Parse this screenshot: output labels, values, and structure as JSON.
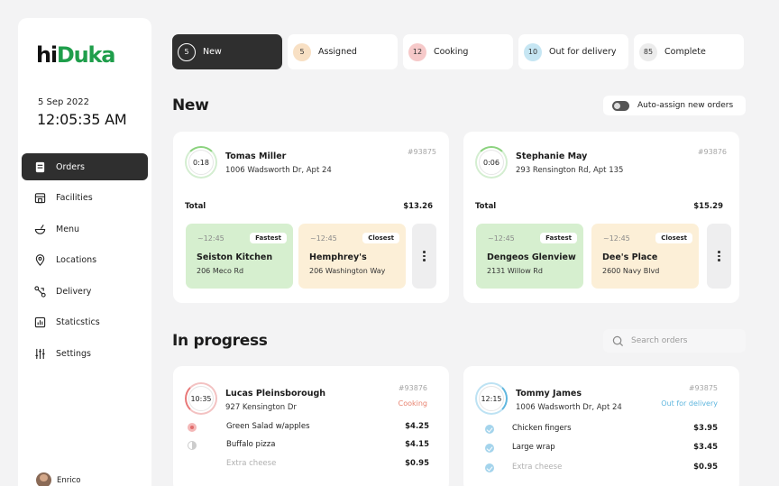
{
  "app": {
    "logo_hi": "hi",
    "logo_duka": "Duka"
  },
  "sidebar": {
    "date": "5 Sep 2022",
    "time": "12:05:35 AM",
    "items": [
      {
        "label": "Orders",
        "icon": "receipt-icon",
        "active": true
      },
      {
        "label": "Facilities",
        "icon": "storefront-icon"
      },
      {
        "label": "Menu",
        "icon": "bowl-icon"
      },
      {
        "label": "Locations",
        "icon": "map-pin-icon"
      },
      {
        "label": "Delivery",
        "icon": "route-icon"
      },
      {
        "label": "Staticstics",
        "icon": "bar-chart-icon"
      },
      {
        "label": "Settings",
        "icon": "sliders-icon"
      }
    ],
    "user": "Enrico"
  },
  "tabs": [
    {
      "count": "5",
      "label": "New",
      "active": true
    },
    {
      "count": "5",
      "label": "Assigned"
    },
    {
      "count": "12",
      "label": "Cooking"
    },
    {
      "count": "10",
      "label": "Out for delivery"
    },
    {
      "count": "85",
      "label": "Complete"
    }
  ],
  "new_section": {
    "title": "New",
    "auto_assign_label": "Auto-assign new orders",
    "orders": [
      {
        "timer": "0:18",
        "name": "Tomas Miller",
        "address": "1006 Wadsworth Dr, Apt 24",
        "id": "#93875",
        "total_label": "Total",
        "total": "$13.26",
        "options": [
          {
            "eta": "~12:45",
            "badge": "Fastest",
            "name": "Seiston Kitchen",
            "address": "206 Meco Rd"
          },
          {
            "eta": "~12:45",
            "badge": "Closest",
            "name": "Hemphrey's",
            "address": "206 Washington Way"
          }
        ]
      },
      {
        "timer": "0:06",
        "name": "Stephanie May",
        "address": "293 Rensington Rd, Apt 135",
        "id": "#93876",
        "total_label": "Total",
        "total": "$15.29",
        "options": [
          {
            "eta": "~12:45",
            "badge": "Fastest",
            "name": "Dengeos Glenview",
            "address": "2131 Willow Rd"
          },
          {
            "eta": "~12:45",
            "badge": "Closest",
            "name": "Dee's Place",
            "address": "2600 Navy Blvd"
          }
        ]
      }
    ]
  },
  "progress_section": {
    "title": "In progress",
    "search_placeholder": "Search orders",
    "orders": [
      {
        "timer": "10:35",
        "name": "Lucas Pleinsborough",
        "address": "927 Kensington Dr",
        "id": "#93876",
        "status": "Cooking",
        "status_color": "#e8826f",
        "items": [
          {
            "name": "Green Salad w/apples",
            "price": "$4.25"
          },
          {
            "name": "Buffalo pizza",
            "price": "$4.15"
          },
          {
            "name": "Extra cheese",
            "price": "$0.95"
          }
        ]
      },
      {
        "timer": "12:15",
        "name": "Tommy James",
        "address": "1006 Wadsworth Dr, Apt 24",
        "id": "#93875",
        "status": "Out for delivery",
        "status_color": "#5fb6de",
        "items": [
          {
            "name": "Chicken fingers",
            "price": "$3.95"
          },
          {
            "name": "Large wrap",
            "price": "$3.45"
          },
          {
            "name": "Extra cheese",
            "price": "$0.95"
          }
        ]
      }
    ]
  }
}
